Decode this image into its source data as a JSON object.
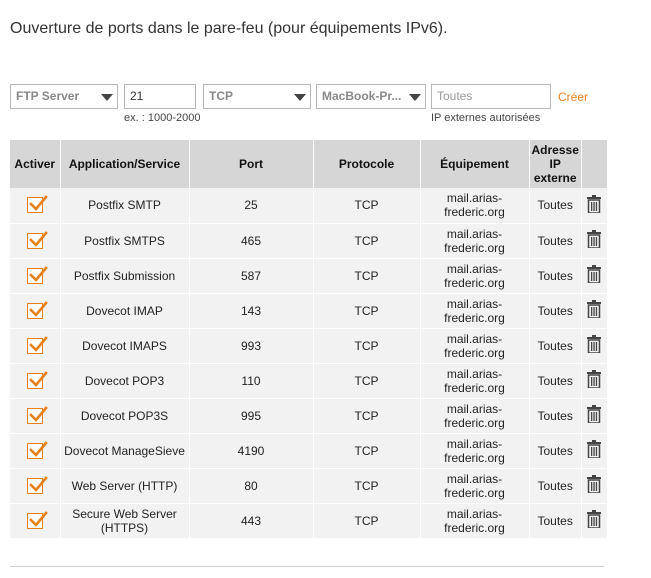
{
  "page": {
    "title": "Ouverture de ports dans le pare-feu (pour équipements IPv6)."
  },
  "form": {
    "application_select": "FTP Server",
    "port_value": "21",
    "port_hint": "ex. : 1000-2000",
    "protocol_select": "TCP",
    "device_select": "MacBook-Pr...",
    "ip_placeholder": "Toutes",
    "ip_hint": "IP externes autorisées",
    "create_label": "Créer"
  },
  "table": {
    "headers": {
      "activate": "Activer",
      "application": "Application/Service",
      "port": "Port",
      "protocol": "Protocole",
      "device": "Équipement",
      "external_ip": [
        "Adresse",
        "IP",
        "externe"
      ]
    },
    "rows": [
      {
        "service": "Postfix SMTP",
        "port": "25",
        "protocol": "TCP",
        "device": [
          "mail.arias-",
          "frederic.org"
        ],
        "ip": "Toutes"
      },
      {
        "service": "Postfix SMTPS",
        "port": "465",
        "protocol": "TCP",
        "device": [
          "mail.arias-",
          "frederic.org"
        ],
        "ip": "Toutes"
      },
      {
        "service": "Postfix Submission",
        "port": "587",
        "protocol": "TCP",
        "device": [
          "mail.arias-",
          "frederic.org"
        ],
        "ip": "Toutes"
      },
      {
        "service": "Dovecot IMAP",
        "port": "143",
        "protocol": "TCP",
        "device": [
          "mail.arias-",
          "frederic.org"
        ],
        "ip": "Toutes"
      },
      {
        "service": "Dovecot IMAPS",
        "port": "993",
        "protocol": "TCP",
        "device": [
          "mail.arias-",
          "frederic.org"
        ],
        "ip": "Toutes"
      },
      {
        "service": "Dovecot POP3",
        "port": "110",
        "protocol": "TCP",
        "device": [
          "mail.arias-",
          "frederic.org"
        ],
        "ip": "Toutes"
      },
      {
        "service": "Dovecot POP3S",
        "port": "995",
        "protocol": "TCP",
        "device": [
          "mail.arias-",
          "frederic.org"
        ],
        "ip": "Toutes"
      },
      {
        "service": "Dovecot ManageSieve",
        "port": "4190",
        "protocol": "TCP",
        "device": [
          "mail.arias-",
          "frederic.org"
        ],
        "ip": "Toutes"
      },
      {
        "service": "Web Server (HTTP)",
        "port": "80",
        "protocol": "TCP",
        "device": [
          "mail.arias-",
          "frederic.org"
        ],
        "ip": "Toutes"
      },
      {
        "service": [
          "Secure Web Server",
          "(HTTPS)"
        ],
        "port": "443",
        "protocol": "TCP",
        "device": [
          "mail.arias-",
          "frederic.org"
        ],
        "ip": "Toutes"
      }
    ]
  },
  "colors": {
    "accent": "#e8801a",
    "header_bg": "#d6d6d6",
    "row_bg": "#f2f2f2"
  },
  "icons": {
    "checkbox": "checkmark-icon",
    "delete": "trash-icon",
    "dropdown": "chevron-down-icon"
  }
}
